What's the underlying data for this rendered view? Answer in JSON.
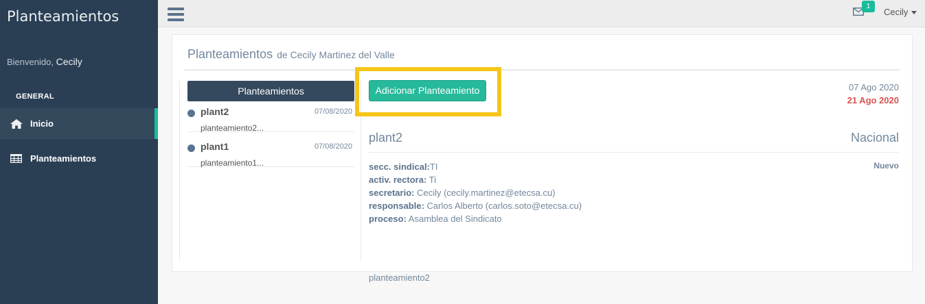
{
  "sidebar": {
    "app_title": "Planteamientos",
    "welcome_label": "Bienvenido,",
    "welcome_user": "Cecily",
    "section_title": "GENERAL",
    "items": [
      {
        "label": "Inicio",
        "icon": "home-icon"
      },
      {
        "label": "Planteamientos",
        "icon": "table-icon"
      }
    ]
  },
  "topnav": {
    "mail_badge": "1",
    "user_name": "Cecily"
  },
  "panel": {
    "title": "Planteamientos",
    "subtitle": "de Cecily Martinez del Valle"
  },
  "list": {
    "header": "Planteamientos",
    "items": [
      {
        "name": "plant2",
        "date": "07/08/2020",
        "desc": "planteamiento2..."
      },
      {
        "name": "plant1",
        "date": "07/08/2020",
        "desc": "planteamiento1..."
      }
    ]
  },
  "detail": {
    "add_button": "Adicionar Planteamiento",
    "date_start": "07 Ago 2020",
    "date_due": "21 Ago 2020",
    "name": "plant2",
    "scope": "Nacional",
    "status": "Nuevo",
    "fields": [
      {
        "label": "secc. sindical:",
        "value": "TI"
      },
      {
        "label": "activ. rectora:",
        "value": " Ti"
      },
      {
        "label": "secretario:",
        "value": " Cecily (cecily.martinez@etecsa.cu)"
      },
      {
        "label": "responsable:",
        "value": " Carlos Alberto (carlos.soto@etecsa.cu)"
      },
      {
        "label": "proceso:",
        "value": " Asamblea del Sindicato"
      }
    ],
    "text": "planteamiento2"
  },
  "colors": {
    "sidebar_bg": "#2a3f54",
    "accent": "#1abb9c",
    "button": "#26b99a",
    "highlight": "#f5c518",
    "due_date": "#d9534f"
  }
}
